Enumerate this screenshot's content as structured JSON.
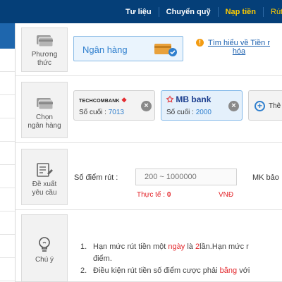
{
  "topnav": {
    "items": [
      {
        "label": "Tư liệu",
        "active": false
      },
      {
        "label": "Chuyển quỹ",
        "active": false
      },
      {
        "label": "Nạp tiền",
        "active": true
      },
      {
        "label": "Rút",
        "active": false
      }
    ]
  },
  "method": {
    "label_line1": "Phương",
    "label_line2": "thức",
    "value": "Ngân hàng",
    "help_line1": "Tìm hiểu về Tiền r",
    "help_line2": "hóa"
  },
  "bank": {
    "label_line1": "Chọn",
    "label_line2": "ngân hàng",
    "suffix_label": "Số cuối :",
    "cards": [
      {
        "logo": "TECHCOMBANK",
        "last_digits": "7013"
      },
      {
        "logo": "MB bank",
        "last_digits": "2000"
      }
    ],
    "add_label": "Thê"
  },
  "withdraw": {
    "label_line1": "Đề xuất",
    "label_line2": "yêu cầu",
    "points_label": "Số điểm rút :",
    "points_placeholder": "200 ~ 1000000",
    "actual_label": "Thực tế :",
    "actual_value": "0",
    "unit": "VNĐ",
    "mk_label": "MK bảo"
  },
  "notes": {
    "label": "Chú ý",
    "items": [
      {
        "num": "1.",
        "pre": "Hạn mức rút tiền một",
        "hl1": "ngày",
        "mid": "là",
        "hl2": "2",
        "post": "lần.Hạn mức r"
      },
      {
        "num": "",
        "pre": "điểm.",
        "hl1": "",
        "mid": "",
        "hl2": "",
        "post": ""
      },
      {
        "num": "2.",
        "pre": "Điều kiện rút tiền số điểm cược phải",
        "hl1": "bằng",
        "mid": "với",
        "hl2": "",
        "post": ""
      }
    ]
  },
  "colors": {
    "topbar": "#053f78",
    "accent_yellow": "#ffcc00",
    "link_blue": "#2f7fce",
    "red": "#e3262b"
  }
}
